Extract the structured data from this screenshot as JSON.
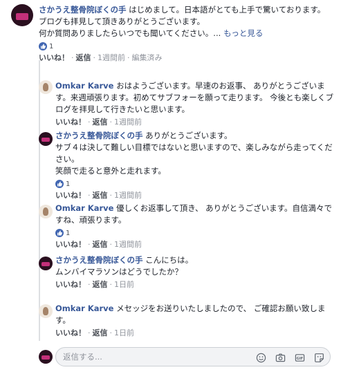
{
  "comments": [
    {
      "author": "さかうえ整骨院ぼくの手",
      "text": "はじめまして。日本語がとても上手で驚いております。\nブログも拝見して頂きありがとうございます。\n何か質問ありましたらいつでも聞いてください。...",
      "see_more": "もっと見る",
      "like_count": "1",
      "actions": {
        "like": "いいね！",
        "reply": "返信",
        "time": "1週間前",
        "edited": "編集済み"
      }
    }
  ],
  "replies": [
    {
      "author": "Omkar Karve",
      "text": "おはようございます。早速のお返事、 ありがとうございます。来週頑張ります。初めてサブフォーを願って走ります。 今後とも楽しくブログを拝見して行きたいと思います。",
      "like_count": "",
      "actions": {
        "like": "いいね！",
        "reply": "返信",
        "time": "1週間前"
      }
    },
    {
      "author": "さかうえ整骨院ぼくの手",
      "text": "ありがとうございます。\nサブ４は決して難しい目標ではないと思いますので、楽しみながら走ってください。\n笑顔で走ると意外と走れます。",
      "like_count": "1",
      "actions": {
        "like": "いいね！",
        "reply": "返信",
        "time": "1週間前"
      }
    },
    {
      "author": "Omkar Karve",
      "text": "優しくお返事して頂き、 ありがとうございます。自信満々ですね、頑張ります。",
      "like_count": "1",
      "actions": {
        "like": "いいね！",
        "reply": "返信",
        "time": "1週間前"
      }
    },
    {
      "author": "さかうえ整骨院ぼくの手",
      "text": "こんにちは。\nムンバイマラソンはどうでしたか？",
      "like_count": "",
      "actions": {
        "like": "いいね！",
        "reply": "返信",
        "time": "1日前"
      }
    },
    {
      "author": "Omkar Karve",
      "text": "メセッジをお送りいたしましたので、 ご確認お願い致します。",
      "like_count": "",
      "actions": {
        "like": "いいね！",
        "reply": "返信",
        "time": "1日前"
      }
    }
  ],
  "composer": {
    "placeholder": "返信する...",
    "icons": [
      "emoji-icon",
      "camera-icon",
      "gif-icon",
      "sticker-icon"
    ]
  },
  "colors": {
    "link": "#385898",
    "meta": "#90949c",
    "like_blue": "#4267b2"
  }
}
